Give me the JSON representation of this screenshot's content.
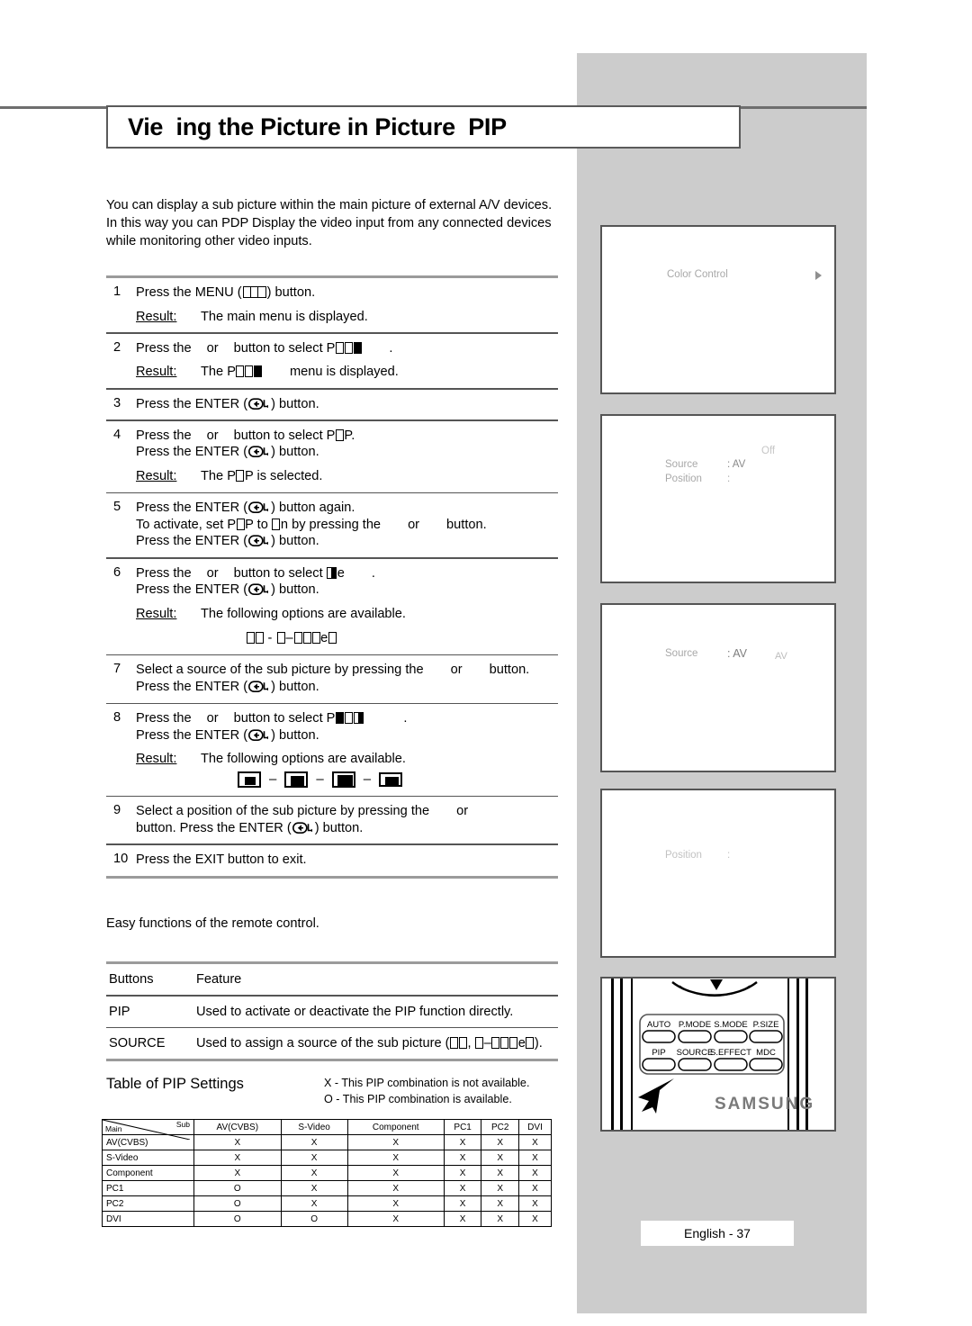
{
  "page": {
    "title": "Vie  ing the Picture in Picture  PIP",
    "footer_label": "English - 37"
  },
  "intro": {
    "paragraph": "You can display a sub picture within the main picture of external A/V devices. In this way you can PDP Display the video input from any connected devices while monitoring other video inputs."
  },
  "steps": [
    {
      "num": "1",
      "line1_pre": "Press the MENU (",
      "line1_post": ") button.",
      "result_label": "Result:",
      "result_text": "The main menu is displayed."
    },
    {
      "num": "2",
      "line1_a": "Press the",
      "line1_b": "or",
      "line1_c": "button to select P",
      "line1_d": ".",
      "result_label": "Result:",
      "result_a": "The P",
      "result_b": "menu is displayed."
    },
    {
      "num": "3",
      "line1_pre": "Press the ENTER (",
      "line1_post": ") button."
    },
    {
      "num": "4",
      "line1_a": "Press the",
      "line1_b": "or",
      "line1_c": "button to select P",
      "line1_d": "P.",
      "line2_pre": "Press the ENTER (",
      "line2_post": ") button.",
      "result_label": "Result:",
      "result_a": "The P",
      "result_b": "P is selected."
    },
    {
      "num": "5",
      "line1_pre": "Press the ENTER (",
      "line1_post": ") button again.",
      "line2_a": "To activate, set P",
      "line2_b": "P to",
      "line2_c": "n by pressing the",
      "line2_d": "or",
      "line2_e": "button.",
      "line3_pre": "Press the ENTER (",
      "line3_post": ") button."
    },
    {
      "num": "6",
      "line1_a": "Press the",
      "line1_b": "or",
      "line1_c": "button to select",
      "line1_d": "e",
      "line1_e": ".",
      "line2_pre": "Press the ENTER (",
      "line2_post": ") button.",
      "result_label": "Result:",
      "result_text": "The following options are available.",
      "options_text": "- -e"
    },
    {
      "num": "7",
      "line1_a": "Select a source of the sub picture by pressing the",
      "line1_b": "or",
      "line1_c": "button.",
      "line2_pre": "Press the ENTER (",
      "line2_post": ") button."
    },
    {
      "num": "8",
      "line1_a": "Press the",
      "line1_b": "or",
      "line1_c": "button to select P",
      "line1_d": ".",
      "line2_pre": "Press the ENTER (",
      "line2_post": ") button.",
      "result_label": "Result:",
      "result_text": "The following options are available."
    },
    {
      "num": "9",
      "line1_a": "Select a position of the sub picture by pressing the",
      "line1_b": "or",
      "line2": "button. Press the ENTER (",
      "line2_post": ") button."
    },
    {
      "num": "10",
      "line1": "Press the EXIT button to exit."
    }
  ],
  "easy_functions": {
    "note": "Easy functions of the remote control."
  },
  "button_table": {
    "header_buttons": "Buttons",
    "header_feature": "Feature",
    "rows": [
      {
        "button": "PIP",
        "feature": "Used to activate or deactivate the PIP function directly."
      },
      {
        "button": "SOURCE",
        "feature_pre": "Used to assign a source of the sub picture (",
        "feature_mid": ",",
        "feature_post": "e",
        "feature_end": ")."
      }
    ]
  },
  "pip_settings": {
    "heading": "Table of PIP Settings",
    "legend_x": "X - This PIP combination is not available.",
    "legend_o": "O - This PIP combination is available.",
    "corner_main": "Main",
    "corner_sub": "Sub",
    "columns": [
      "AV(CVBS)",
      "S-Video",
      "Component",
      "PC1",
      "PC2",
      "DVI"
    ],
    "rows": [
      {
        "name": "AV(CVBS)",
        "values": [
          "X",
          "X",
          "X",
          "X",
          "X",
          "X"
        ]
      },
      {
        "name": "S-Video",
        "values": [
          "X",
          "X",
          "X",
          "X",
          "X",
          "X"
        ]
      },
      {
        "name": "Component",
        "values": [
          "X",
          "X",
          "X",
          "X",
          "X",
          "X"
        ]
      },
      {
        "name": "PC1",
        "values": [
          "O",
          "X",
          "X",
          "X",
          "X",
          "X"
        ]
      },
      {
        "name": "PC2",
        "values": [
          "O",
          "X",
          "X",
          "X",
          "X",
          "X"
        ]
      },
      {
        "name": "DVI",
        "values": [
          "O",
          "O",
          "X",
          "X",
          "X",
          "X"
        ]
      }
    ]
  },
  "osd_panels": [
    {
      "id": "panel-color-control",
      "label": "Color Control",
      "arrow": "right-arrow-icon"
    },
    {
      "id": "panel-pip-off",
      "off_label": "Off",
      "source_label": "Source",
      "source_value": ": AV",
      "position_label": "Position",
      "position_value": ":"
    },
    {
      "id": "panel-source-av",
      "source_label": "Source",
      "source_value": ": AV",
      "source_badge": "AV"
    },
    {
      "id": "panel-position",
      "position_label": "Position",
      "position_value": ":"
    }
  ],
  "remote": {
    "brand": "SAMSUNG",
    "buttons_row1": [
      "AUTO",
      "P.MODE",
      "S.MODE",
      "P.SIZE"
    ],
    "buttons_row2": [
      "PIP",
      "SOURCE",
      "S.EFFECT",
      "MDC"
    ]
  },
  "colors": {
    "gray_panel": "#cccccc",
    "rule": "#9b9b9b",
    "osd_text": "#a8a8a8",
    "border": "#555555"
  }
}
